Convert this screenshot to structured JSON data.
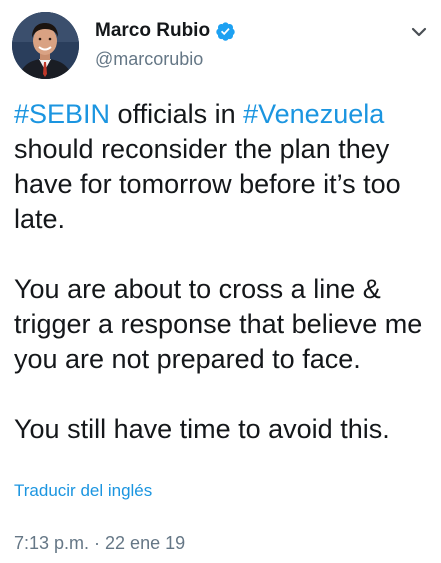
{
  "author": {
    "name": "Marco Rubio",
    "handle": "@marcorubio",
    "verified": true
  },
  "tweet": {
    "p1": {
      "hashtag1": "#SEBIN",
      "text1": " officials in ",
      "hashtag2": "#Venezuela",
      "text2": " should reconsider the plan they have for tomorrow before it’s too late."
    },
    "p2": "You are about to cross a line & trigger a response that believe me you are not prepared to face.",
    "p3": "You still have time to avoid this."
  },
  "translate_label": "Traducir del inglés",
  "timestamp": "7:13 p.m. · 22 ene 19",
  "icons": {
    "verified": "verified-badge-icon",
    "menu": "chevron-down-icon"
  },
  "colors": {
    "link": "#1b95e0",
    "verified": "#1da1f2",
    "secondary_text": "#657786"
  }
}
